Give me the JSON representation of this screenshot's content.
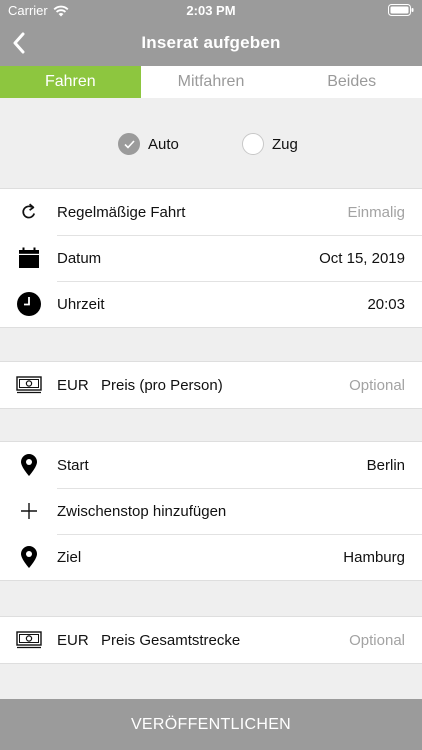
{
  "status_bar": {
    "carrier": "Carrier",
    "time": "2:03 PM"
  },
  "nav": {
    "title": "Inserat aufgeben"
  },
  "tabs": [
    {
      "label": "Fahren",
      "active": true
    },
    {
      "label": "Mitfahren",
      "active": false
    },
    {
      "label": "Beides",
      "active": false
    }
  ],
  "mode": {
    "auto_label": "Auto",
    "auto_selected": true,
    "zug_label": "Zug",
    "zug_selected": false
  },
  "schedule": {
    "recurring_label": "Regelmäßige Fahrt",
    "recurring_value": "Einmalig",
    "date_label": "Datum",
    "date_value": "Oct 15, 2019",
    "time_label": "Uhrzeit",
    "time_value": "20:03"
  },
  "price_per_person": {
    "currency": "EUR",
    "label": "Preis (pro Person)",
    "placeholder": "Optional"
  },
  "route": {
    "start_label": "Start",
    "start_value": "Berlin",
    "stop_label": "Zwischenstop hinzufügen",
    "end_label": "Ziel",
    "end_value": "Hamburg"
  },
  "price_total": {
    "currency": "EUR",
    "label": "Preis Gesamtstrecke",
    "placeholder": "Optional"
  },
  "publish_label": "VERÖFFENTLICHEN",
  "colors": {
    "accent": "#8dc63f",
    "bar": "#9b9b9b"
  },
  "icons": [
    "wifi-icon",
    "battery-icon",
    "back-chevron-icon",
    "check-icon",
    "repeat-icon",
    "calendar-icon",
    "clock-icon",
    "banknote-icon",
    "location-pin-icon",
    "plus-icon"
  ]
}
